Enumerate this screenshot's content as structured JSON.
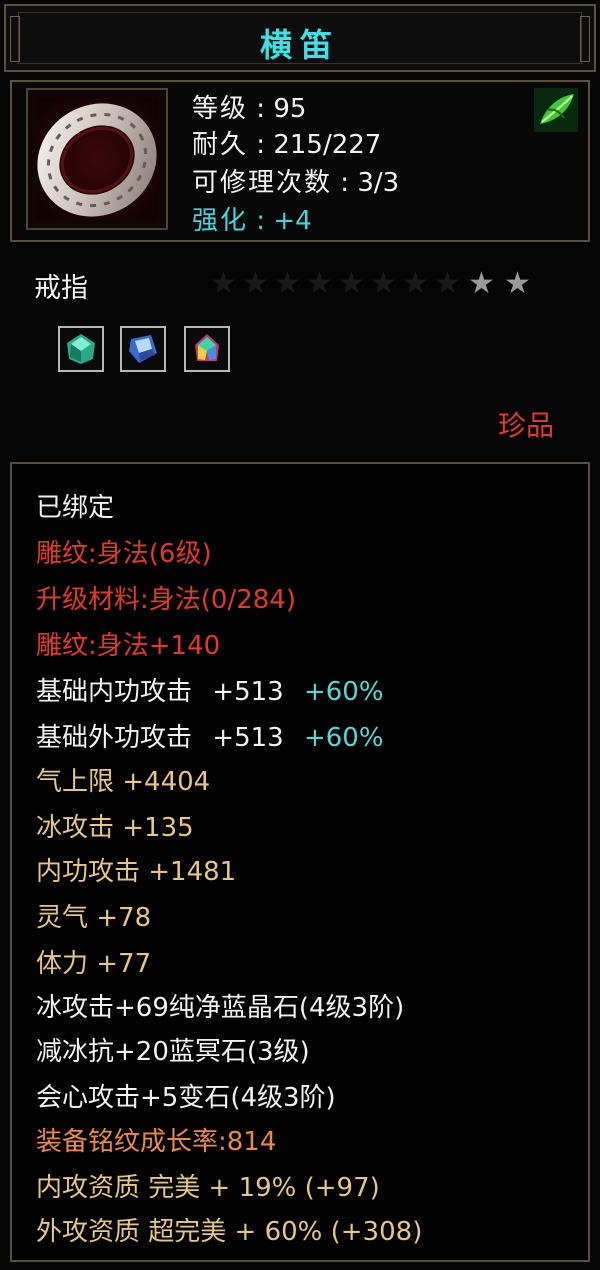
{
  "title": "横笛",
  "header": {
    "level_label": "等级",
    "level_value": "95",
    "durability_label": "耐久",
    "durability_value": "215/227",
    "repair_label": "可修理次数",
    "repair_value": "3/3",
    "enhance_label": "强化",
    "enhance_value": "+4",
    "item_icon": "ring-icon",
    "badge_icon": "leaf-icon"
  },
  "type": {
    "label": "戒指",
    "stars_total": 10,
    "stars_lit": 2,
    "rarity": "珍品"
  },
  "gems": [
    {
      "icon": "green-gem-icon",
      "color": "#3fd0a8"
    },
    {
      "icon": "blue-gem-icon",
      "color": "#4a8ae8"
    },
    {
      "icon": "rainbow-gem-icon",
      "color": "#d04a7a"
    }
  ],
  "attributes": {
    "bound": "已绑定",
    "engrave": "雕纹:身法(6级)",
    "upgrade_material": "升级材料:身法(0/284)",
    "engrave_bonus": "雕纹:身法+140",
    "base_inner_atk_label": "基础内功攻击",
    "base_inner_atk_value": "+513",
    "base_inner_atk_pct": "+60%",
    "base_outer_atk_label": "基础外功攻击",
    "base_outer_atk_value": "+513",
    "base_outer_atk_pct": "+60%",
    "qi_max": "气上限  +4404",
    "ice_atk": "冰攻击  +135",
    "inner_atk": "内功攻击  +1481",
    "spirit": "灵气  +78",
    "stamina": "体力  +77",
    "gem1": "冰攻击+69纯净蓝晶石(4级3阶)",
    "gem2": "减冰抗+20蓝冥石(3级)",
    "gem3": "会心攻击+5变石(4级3阶)",
    "growth": "装备铭纹成长率:814",
    "inner_quality": "内攻资质  完美  +  19%  (+97)",
    "outer_quality": "外攻资质  超完美  +  60%  (+308)"
  },
  "colors": {
    "title": "#3fe0e6",
    "red": "#e23a2a",
    "gold": "#e8c488",
    "orange": "#ea8a4a",
    "cyan": "#55d8d8",
    "border": "#5a5040"
  }
}
